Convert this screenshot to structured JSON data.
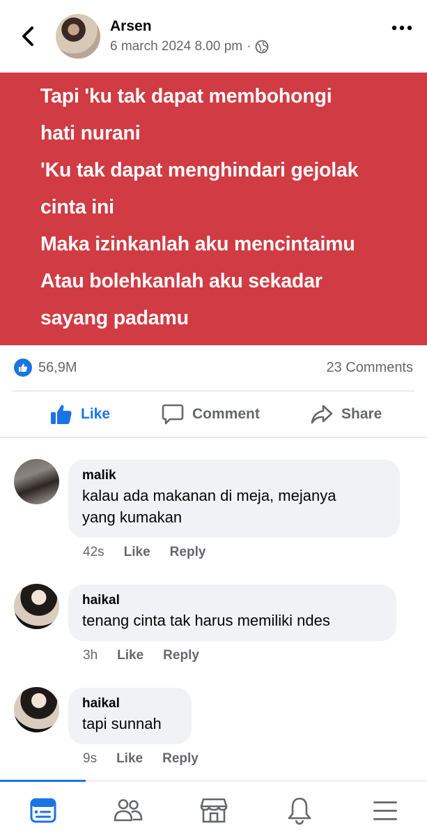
{
  "header": {
    "author_name": "Arsen",
    "timestamp": "6 march 2024 8.00 pm",
    "separator": "·",
    "audience_icon": "globe-icon"
  },
  "post": {
    "background_color": "#d13b43",
    "lines": [
      "Tapi 'ku tak dapat membohongi",
      "hati nurani",
      "'Ku tak dapat menghindari gejolak",
      "cinta ini",
      "Maka izinkanlah aku mencintaimu",
      "Atau bolehkanlah aku sekadar",
      "sayang padamu"
    ]
  },
  "stats": {
    "reaction_count": "56,9M",
    "comment_count": "23 Comments"
  },
  "actions": {
    "like": "Like",
    "comment": "Comment",
    "share": "Share"
  },
  "comments": [
    {
      "author": "malik",
      "text_lines": [
        "kalau ada makanan di meja, mejanya",
        "yang kumakan"
      ],
      "time": "42s",
      "like": "Like",
      "reply": "Reply"
    },
    {
      "author": "haikal",
      "text_lines": [
        "tenang cinta tak harus memiliki ndes"
      ],
      "time": "3h",
      "like": "Like",
      "reply": "Reply"
    },
    {
      "author": "haikal",
      "text_lines": [
        "tapi sunnah"
      ],
      "time": "9s",
      "like": "Like",
      "reply": "Reply"
    }
  ],
  "bottom_nav": {
    "items": [
      "feed-icon",
      "friends-icon",
      "marketplace-icon",
      "notifications-icon",
      "menu-icon"
    ],
    "active_index": 0
  },
  "colors": {
    "accent": "#1b74e4",
    "secondary_text": "#65676b",
    "bubble": "#f0f2f5"
  }
}
